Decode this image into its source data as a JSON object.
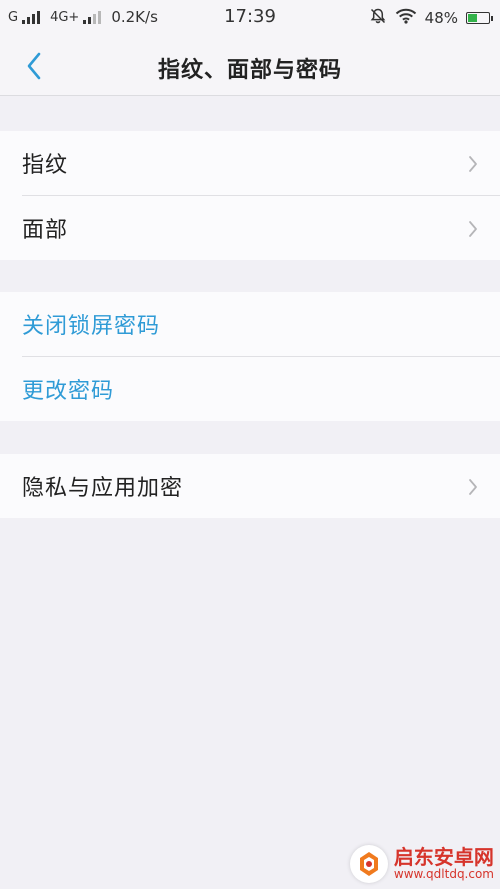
{
  "status_bar": {
    "carrier1": "G",
    "carrier2": "4G+",
    "speed": "0.2K/s",
    "time": "17:39",
    "battery": "48%",
    "battery_level": 0.48,
    "battery_color": "#33b24a",
    "icons": [
      "signal-icon",
      "signal-icon",
      "mute-bell-icon",
      "wifi-icon",
      "battery-icon"
    ]
  },
  "nav": {
    "back_icon": "chevron-left-icon",
    "title": "指纹、面部与密码"
  },
  "groups": [
    {
      "items": [
        {
          "label": "指纹",
          "chevron": true
        },
        {
          "label": "面部",
          "chevron": true
        }
      ]
    },
    {
      "items": [
        {
          "label": "关闭锁屏密码",
          "chevron": false
        },
        {
          "label": "更改密码",
          "chevron": false
        }
      ]
    },
    {
      "items": [
        {
          "label": "隐私与应用加密",
          "chevron": true
        }
      ]
    }
  ],
  "colors": {
    "accent_blue": "#2f9bd6",
    "background": "#f1f0f5",
    "watermark_red": "#d6342b"
  },
  "watermark": {
    "name": "启东安卓网",
    "url": "www.qdltdq.com"
  }
}
